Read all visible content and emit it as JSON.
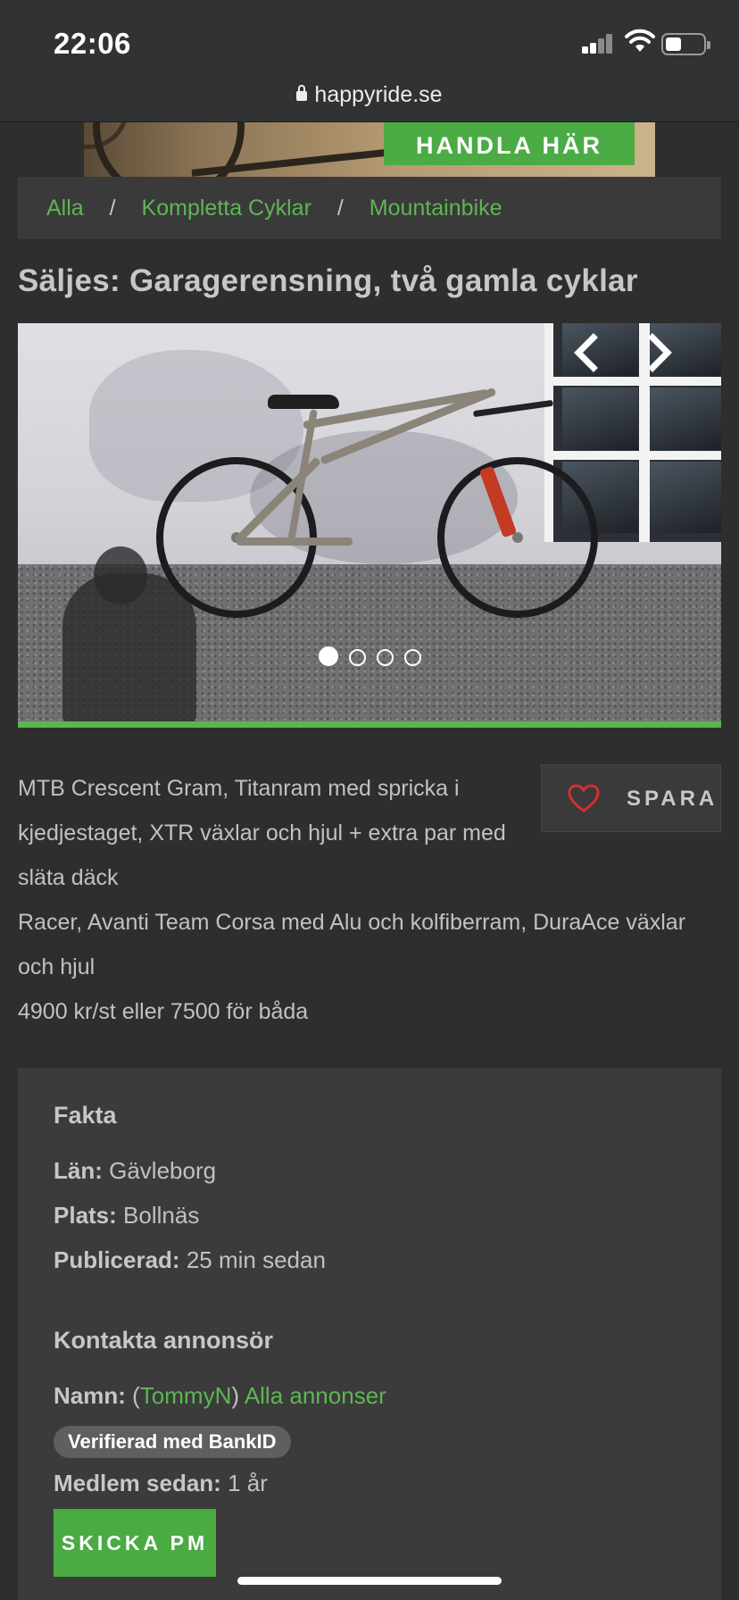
{
  "status_bar": {
    "time": "22:06"
  },
  "browser": {
    "url": "happyride.se"
  },
  "banner": {
    "cta_label": "HANDLA HÄR"
  },
  "breadcrumb": [
    {
      "label": "Alla"
    },
    {
      "label": "Kompletta Cyklar"
    },
    {
      "label": "Mountainbike"
    }
  ],
  "breadcrumb_separator": "/",
  "listing": {
    "title": "Säljes: Garagerensning, två gamla cyklar",
    "carousel": {
      "slide_count": 4,
      "active_index": 0
    },
    "description": [
      "MTB Crescent Gram, Titanram med spricka i kjedjestaget, XTR växlar och hjul + extra par med släta däck",
      "Racer, Avanti Team Corsa med Alu och kolfiberram, DuraAce växlar och hjul",
      "4900 kr/st eller 7500 för båda"
    ],
    "save_label": "SPARA"
  },
  "facts": {
    "heading": "Fakta",
    "lan_label": "Län:",
    "lan_value": "Gävleborg",
    "plats_label": "Plats:",
    "plats_value": "Bollnäs",
    "publicerad_label": "Publicerad:",
    "publicerad_value": "25 min sedan"
  },
  "contact": {
    "heading": "Kontakta annonsör",
    "namn_label": "Namn:",
    "username": "TommyN",
    "all_ads_link": "Alla annonser",
    "verified_badge": "Verifierad med BankID",
    "member_label": "Medlem sedan:",
    "member_value": "1 år",
    "pm_button": "SKICKA PM"
  },
  "colors": {
    "accent_green": "#4bab45",
    "link_green": "#5eb653",
    "heart_red": "#d32f2f"
  },
  "icons": [
    "lock-icon",
    "signal-icon",
    "wifi-icon",
    "battery-icon",
    "chevron-left-icon",
    "chevron-right-icon",
    "heart-icon"
  ]
}
